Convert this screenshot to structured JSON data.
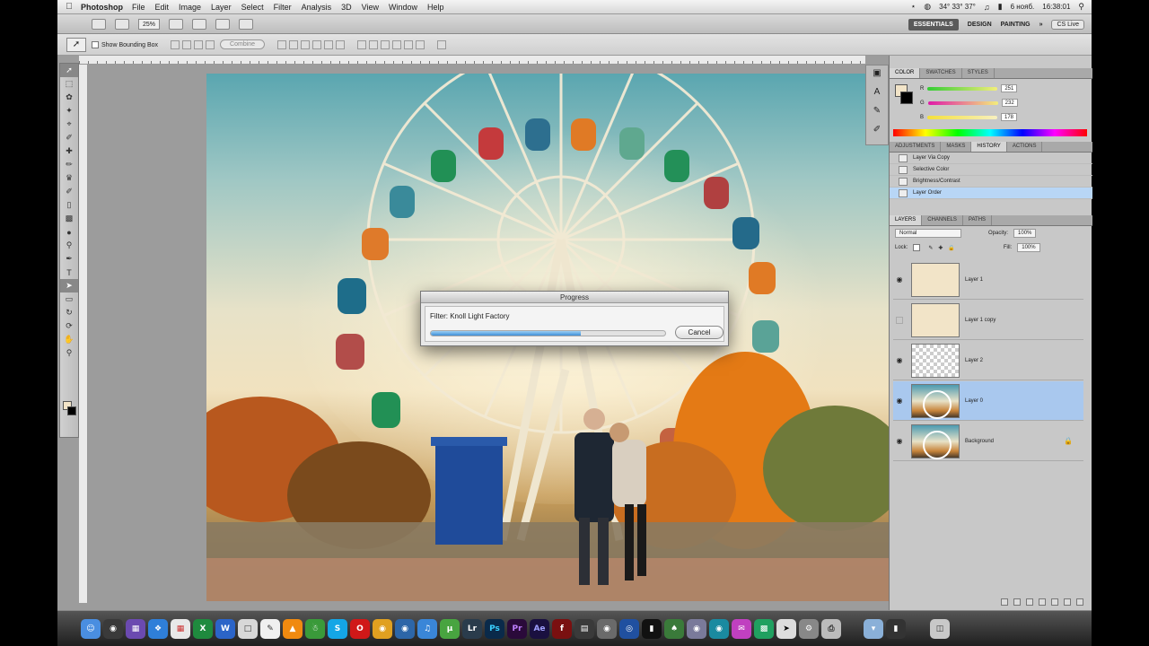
{
  "menubar": {
    "app_name": "Photoshop",
    "items": [
      "File",
      "Edit",
      "Image",
      "Layer",
      "Select",
      "Filter",
      "Analysis",
      "3D",
      "View",
      "Window",
      "Help"
    ],
    "status_time": "16:38:01",
    "status_temp": "34° 33° 37°",
    "status_date": "6 нояб."
  },
  "appbar": {
    "zoom": "25%",
    "workspaces": [
      "ESSENTIALS",
      "DESIGN",
      "PAINTING"
    ],
    "active_workspace": "ESSENTIALS",
    "more": "»",
    "cs_live": "CS Live"
  },
  "options": {
    "show_bounding_box": "Show Bounding Box",
    "combine_label": "Combine"
  },
  "dialog": {
    "title": "Progress",
    "message": "Filter: Knoll Light Factory",
    "progress": 0.64,
    "cancel_label": "Cancel"
  },
  "color_panel": {
    "tabs": [
      "COLOR",
      "SWATCHES",
      "STYLES"
    ],
    "r": "251",
    "g": "232",
    "b": "178",
    "r_label": "R",
    "g_label": "G",
    "b_label": "B"
  },
  "history_panel": {
    "tabs": [
      "ADJUSTMENTS",
      "MASKS",
      "HISTORY",
      "ACTIONS"
    ],
    "items": [
      "Layer Via Copy",
      "Selective Color",
      "Brightness/Contrast",
      "Layer Order"
    ]
  },
  "layers_panel": {
    "tabs": [
      "LAYERS",
      "CHANNELS",
      "PATHS"
    ],
    "blend_mode": "Normal",
    "opacity_label": "Opacity:",
    "opacity": "100%",
    "lock_label": "Lock:",
    "fill_label": "Fill:",
    "fill": "100%",
    "layers": [
      {
        "name": "Layer 1",
        "visible": true
      },
      {
        "name": "Layer 1 copy",
        "visible": false
      },
      {
        "name": "Layer 2",
        "visible": true
      },
      {
        "name": "Layer 0",
        "visible": true
      },
      {
        "name": "Background",
        "visible": true
      }
    ]
  },
  "dock_apps": [
    "Finder",
    "Dashboard",
    "Mission Control",
    "Safari",
    "Calendar",
    "Excel",
    "Word",
    "Preview",
    "Notes",
    "VLC",
    "Automator",
    "Skype",
    "Opera",
    "Chrome",
    "Network",
    "iTunes",
    "uTorrent",
    "Lightroom",
    "Photoshop",
    "Premiere",
    "After Effects",
    "FlashPlayer",
    "Media Encoder",
    "Steam",
    "Eye",
    "Terminal",
    "Tree",
    "Disk",
    "Game",
    "Mail",
    "Cursor",
    "Pref",
    "Print",
    "Drive",
    "Trash"
  ]
}
